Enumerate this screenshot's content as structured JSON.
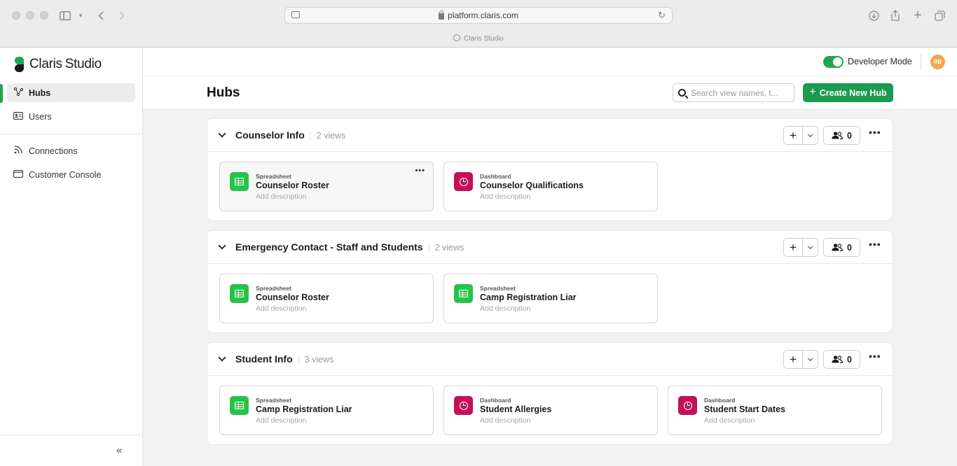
{
  "browser": {
    "url": "platform.claris.com",
    "tab_title": "Claris Studio"
  },
  "brand": {
    "name_a": "Claris",
    "name_b": "Studio"
  },
  "sidebar": {
    "items": [
      {
        "label": "Hubs",
        "icon": "hubs-icon"
      },
      {
        "label": "Users",
        "icon": "users-card-icon"
      },
      {
        "label": "Connections",
        "icon": "connections-icon"
      },
      {
        "label": "Customer Console",
        "icon": "console-icon"
      }
    ],
    "collapse_glyph": "«"
  },
  "topbar": {
    "developer_mode_label": "Developer Mode",
    "developer_mode_on": true,
    "avatar_initials": "RB"
  },
  "page": {
    "title": "Hubs",
    "search_placeholder": "Search view names, t...",
    "create_label": "Create New Hub"
  },
  "colors": {
    "accent": "#1a9b4f",
    "spreadsheet": "#27c24a",
    "dashboard": "#c0115a",
    "avatar": "#f2a64d"
  },
  "hubs": [
    {
      "name": "Counselor Info",
      "count": "2 views",
      "share_count": "0",
      "views": [
        {
          "type": "Spreadsheet",
          "name": "Counselor Roster",
          "desc": "Add description"
        },
        {
          "type": "Dashboard",
          "name": "Counselor Qualifications",
          "desc": "Add description"
        }
      ]
    },
    {
      "name": "Emergency Contact - Staff and Students",
      "count": "2 views",
      "share_count": "0",
      "views": [
        {
          "type": "Spreadsheet",
          "name": "Counselor Roster",
          "desc": "Add description"
        },
        {
          "type": "Spreadsheet",
          "name": "Camp Registration Liar",
          "desc": "Add description"
        }
      ]
    },
    {
      "name": "Student Info",
      "count": "3 views",
      "share_count": "0",
      "views": [
        {
          "type": "Spreadsheet",
          "name": "Camp Registration Liar",
          "desc": "Add description"
        },
        {
          "type": "Dashboard",
          "name": "Student Allergies",
          "desc": "Add description"
        },
        {
          "type": "Dashboard",
          "name": "Student Start Dates",
          "desc": "Add description"
        }
      ]
    }
  ]
}
